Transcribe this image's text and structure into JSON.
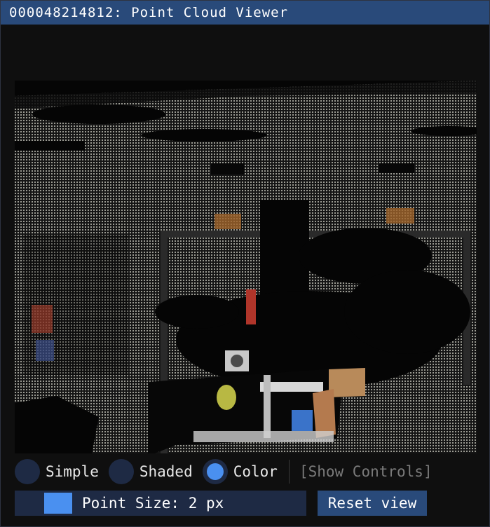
{
  "window": {
    "title": "000048214812: Point Cloud Viewer"
  },
  "render_modes": {
    "options": [
      {
        "label": "Simple",
        "selected": false
      },
      {
        "label": "Shaded",
        "selected": false
      },
      {
        "label": "Color",
        "selected": true
      }
    ]
  },
  "show_controls_label": "[Show Controls]",
  "point_size": {
    "label": "Point Size: 2 px",
    "value": 2
  },
  "reset_view_label": "Reset view",
  "colors": {
    "title_bar": "#294a7a",
    "accent": "#4a90f0",
    "frame": "#1e2a44",
    "background": "#0d0d0d"
  }
}
